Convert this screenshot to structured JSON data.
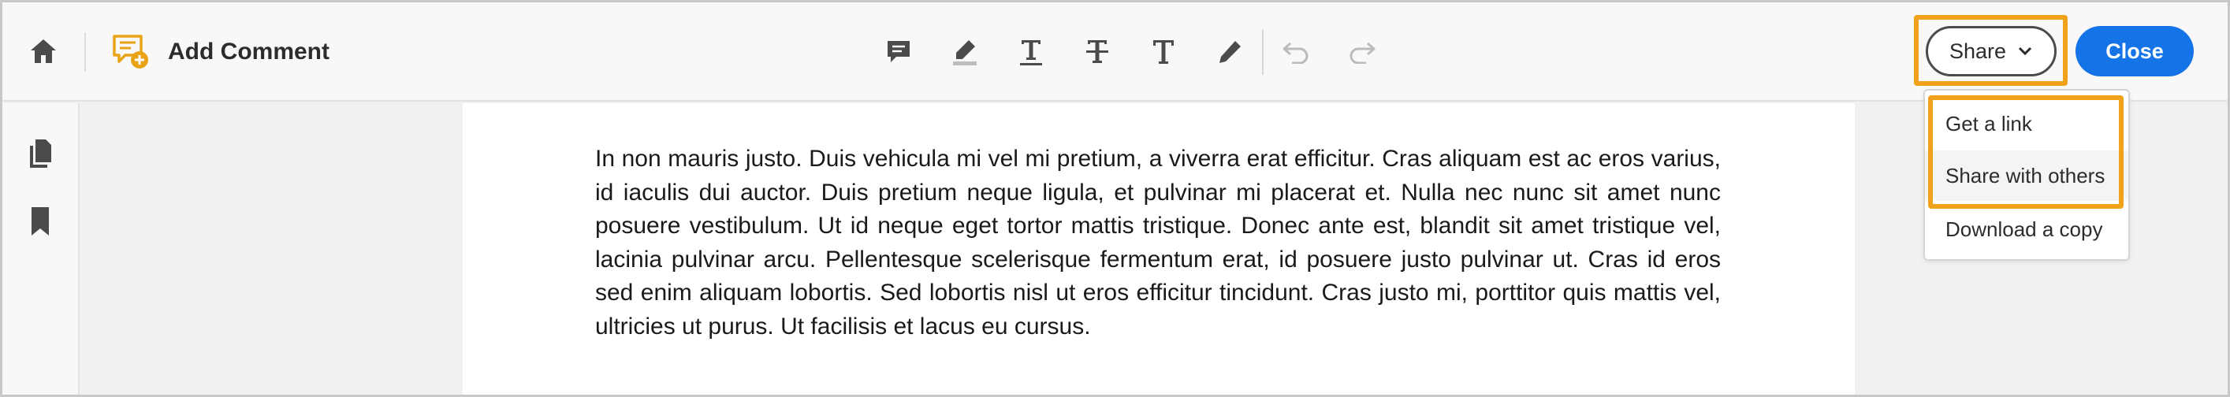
{
  "toolbar": {
    "mode_label": "Add Comment",
    "tools": [
      {
        "icon": "sticky-note-icon",
        "enabled": true
      },
      {
        "icon": "highlight-icon",
        "enabled": true
      },
      {
        "icon": "underline-text-icon",
        "enabled": true
      },
      {
        "icon": "strikethrough-text-icon",
        "enabled": true
      },
      {
        "icon": "add-text-icon",
        "enabled": true
      },
      {
        "icon": "draw-pencil-icon",
        "enabled": true
      },
      {
        "icon": "undo-icon",
        "enabled": false
      },
      {
        "icon": "redo-icon",
        "enabled": false
      }
    ],
    "share_label": "Share",
    "close_label": "Close"
  },
  "share_menu": {
    "items": [
      {
        "label": "Get a link"
      },
      {
        "label": "Share with others"
      },
      {
        "label": "Download a copy"
      }
    ]
  },
  "document": {
    "body": "In non mauris justo. Duis vehicula mi vel mi pretium, a viverra erat efficitur. Cras aliquam est ac eros varius, id iaculis dui auctor. Duis pretium neque ligula, et pulvinar mi placerat et. Nulla nec nunc sit amet nunc posuere vestibulum. Ut id neque eget tortor mattis tristique. Donec ante est, blandit sit amet tristique vel, lacinia pulvinar arcu. Pellentesque scelerisque fermentum erat, id posuere justo pulvinar ut. Cras id eros sed enim aliquam lobortis. Sed lobortis nisl ut eros efficitur tincidunt. Cras justo mi, porttitor quis mattis vel, ultricies ut purus. Ut facilisis et lacus eu cursus."
  },
  "colors": {
    "accent_blue": "#1473e6",
    "highlight_orange": "#f0a21b",
    "comment_icon_yellow": "#e8a317"
  }
}
